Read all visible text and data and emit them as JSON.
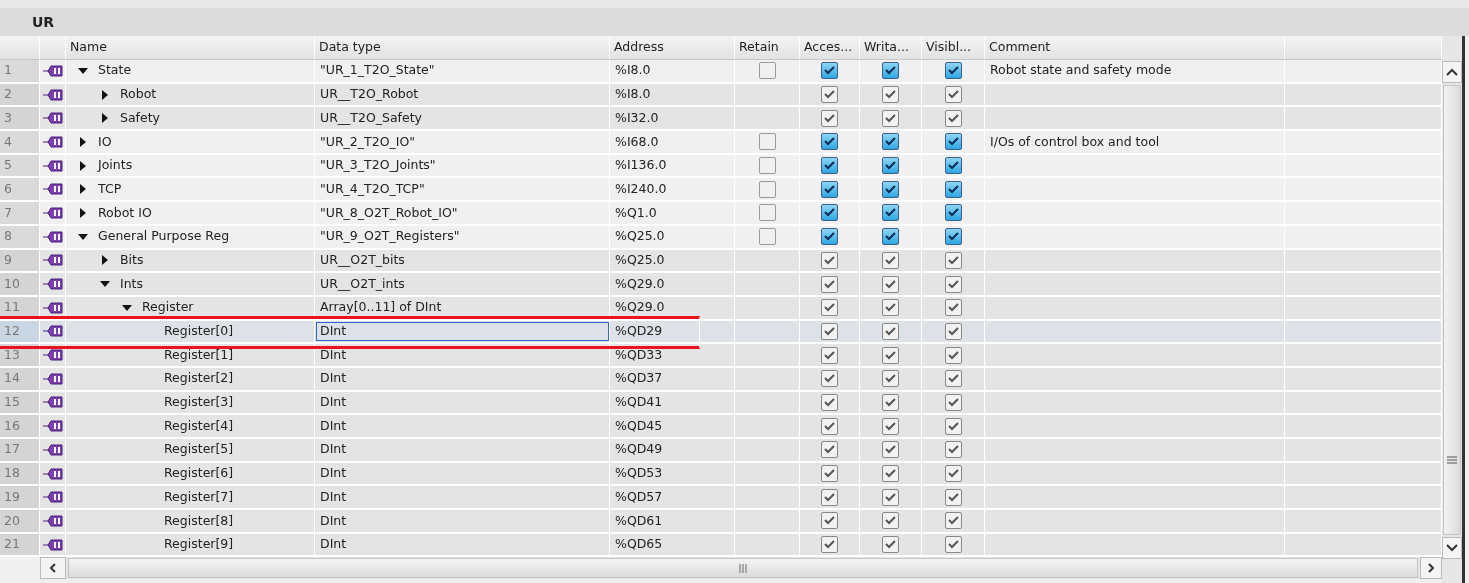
{
  "title": "UR",
  "columns": [
    "Name",
    "Data type",
    "Address",
    "Retain",
    "Acces...",
    "Writa...",
    "Visibl...",
    "Comment"
  ],
  "rows": [
    {
      "number": "1",
      "name": "State",
      "expanded": true,
      "data_type": "\"UR_1_T2O_State\"",
      "address": "%I8.0",
      "retain": false,
      "accessible": true,
      "writable": true,
      "visible": true,
      "editable": true,
      "comment": "Robot state and safety mode",
      "selected": false,
      "children": [
        {
          "number": "2",
          "name": "Robot",
          "expanded": false,
          "data_type": "UR__T2O_Robot",
          "address": "%I8.0",
          "accessible": true,
          "writable": true,
          "visible": true,
          "editable": false,
          "selected": false
        },
        {
          "number": "3",
          "name": "Safety",
          "expanded": false,
          "data_type": "UR__T2O_Safety",
          "address": "%I32.0",
          "accessible": true,
          "writable": true,
          "visible": true,
          "editable": false,
          "selected": false
        }
      ]
    },
    {
      "number": "4",
      "name": "IO",
      "expanded": false,
      "data_type": "\"UR_2_T2O_IO\"",
      "address": "%I68.0",
      "retain": false,
      "accessible": true,
      "writable": true,
      "visible": true,
      "editable": true,
      "comment": "I/Os of control box and tool",
      "selected": false
    },
    {
      "number": "5",
      "name": "Joints",
      "expanded": false,
      "data_type": "\"UR_3_T2O_Joints\"",
      "address": "%I136.0",
      "retain": false,
      "accessible": true,
      "writable": true,
      "visible": true,
      "editable": true,
      "selected": false
    },
    {
      "number": "6",
      "name": "TCP",
      "expanded": false,
      "data_type": "\"UR_4_T2O_TCP\"",
      "address": "%I240.0",
      "retain": false,
      "accessible": true,
      "writable": true,
      "visible": true,
      "editable": true,
      "selected": false
    },
    {
      "number": "7",
      "name": "Robot IO",
      "expanded": false,
      "data_type": "\"UR_8_O2T_Robot_IO\"",
      "address": "%Q1.0",
      "retain": false,
      "accessible": true,
      "writable": true,
      "visible": true,
      "editable": true,
      "selected": false
    },
    {
      "number": "8",
      "name": "General Purpose Reg",
      "expanded": true,
      "data_type": "\"UR_9_O2T_Registers\"",
      "address": "%Q25.0",
      "retain": false,
      "accessible": true,
      "writable": true,
      "visible": true,
      "editable": true,
      "selected": false,
      "children": [
        {
          "number": "9",
          "name": "Bits",
          "expanded": false,
          "data_type": "UR__O2T_bits",
          "address": "%Q25.0",
          "accessible": true,
          "writable": true,
          "visible": true,
          "editable": false,
          "selected": false
        },
        {
          "number": "10",
          "name": "Ints",
          "expanded": true,
          "data_type": "UR__O2T_ints",
          "address": "%Q29.0",
          "accessible": true,
          "writable": true,
          "visible": true,
          "editable": false,
          "selected": false,
          "children": [
            {
              "number": "11",
              "name": "Register",
              "expanded": true,
              "data_type": "Array[0..11] of DInt",
              "address": "%Q29.0",
              "accessible": true,
              "writable": true,
              "visible": true,
              "editable": false,
              "selected": false,
              "children": [
                {
                  "number": "12",
                  "name": "Register[0]",
                  "data_type": "DInt",
                  "address": "%QD29",
                  "accessible": true,
                  "writable": true,
                  "visible": true,
                  "editable": false,
                  "selected": true
                },
                {
                  "number": "13",
                  "name": "Register[1]",
                  "data_type": "DInt",
                  "address": "%QD33",
                  "accessible": true,
                  "writable": true,
                  "visible": true,
                  "editable": false,
                  "selected": false
                },
                {
                  "number": "14",
                  "name": "Register[2]",
                  "data_type": "DInt",
                  "address": "%QD37",
                  "accessible": true,
                  "writable": true,
                  "visible": true,
                  "editable": false,
                  "selected": false
                },
                {
                  "number": "15",
                  "name": "Register[3]",
                  "data_type": "DInt",
                  "address": "%QD41",
                  "accessible": true,
                  "writable": true,
                  "visible": true,
                  "editable": false,
                  "selected": false
                },
                {
                  "number": "16",
                  "name": "Register[4]",
                  "data_type": "DInt",
                  "address": "%QD45",
                  "accessible": true,
                  "writable": true,
                  "visible": true,
                  "editable": false,
                  "selected": false
                },
                {
                  "number": "17",
                  "name": "Register[5]",
                  "data_type": "DInt",
                  "address": "%QD49",
                  "accessible": true,
                  "writable": true,
                  "visible": true,
                  "editable": false,
                  "selected": false
                },
                {
                  "number": "18",
                  "name": "Register[6]",
                  "data_type": "DInt",
                  "address": "%QD53",
                  "accessible": true,
                  "writable": true,
                  "visible": true,
                  "editable": false,
                  "selected": false
                },
                {
                  "number": "19",
                  "name": "Register[7]",
                  "data_type": "DInt",
                  "address": "%QD57",
                  "accessible": true,
                  "writable": true,
                  "visible": true,
                  "editable": false,
                  "selected": false
                },
                {
                  "number": "20",
                  "name": "Register[8]",
                  "data_type": "DInt",
                  "address": "%QD61",
                  "accessible": true,
                  "writable": true,
                  "visible": true,
                  "editable": false,
                  "selected": false
                },
                {
                  "number": "21",
                  "name": "Register[9]",
                  "data_type": "DInt",
                  "address": "%QD65",
                  "accessible": true,
                  "writable": true,
                  "visible": true,
                  "editable": false,
                  "selected": false
                }
              ]
            }
          ]
        }
      ]
    }
  ]
}
